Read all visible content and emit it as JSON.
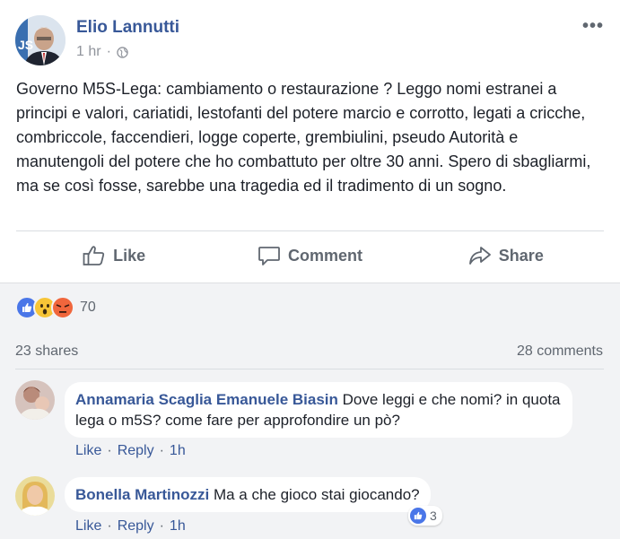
{
  "post": {
    "author": "Elio Lannutti",
    "time": "1 hr",
    "separator": "·",
    "privacy_icon": "globe-icon",
    "text": "Governo M5S-Lega: cambiamento o restaurazione ? Leggo nomi estranei a principi e valori, cariatidi, lestofanti del potere marcio e corrotto, legati a cricche, combriccole, faccendieri, logge coperte, grembiulini, pseudo Autorità e manutengoli del potere che ho combattuto per oltre 30 anni. Spero di sbagliarmi, ma se così fosse, sarebbe una tragedia ed il tradimento di un sogno.",
    "more_icon": "•••"
  },
  "actions": {
    "like": "Like",
    "comment": "Comment",
    "share": "Share"
  },
  "reactions": {
    "count": "70",
    "types": [
      "like",
      "wow",
      "angry"
    ]
  },
  "stats": {
    "shares": "23 shares",
    "comments": "28 comments"
  },
  "comments": [
    {
      "author": "Annamaria Scaglia Emanuele Biasin",
      "text": " Dove leggi e che nomi? in quota lega o m5S? come fare per approfondire un pò?",
      "like": "Like",
      "reply": "Reply",
      "time": "1h"
    },
    {
      "author": "Bonella Martinozzi",
      "text": " Ma a che gioco stai giocando?",
      "like": "Like",
      "reply": "Reply",
      "time": "1h",
      "likes": "3"
    }
  ],
  "colors": {
    "link": "#385898",
    "muted": "#606770",
    "like_blue": "#4a76e8",
    "angry": "#f0663c",
    "wow": "#f7c537"
  }
}
